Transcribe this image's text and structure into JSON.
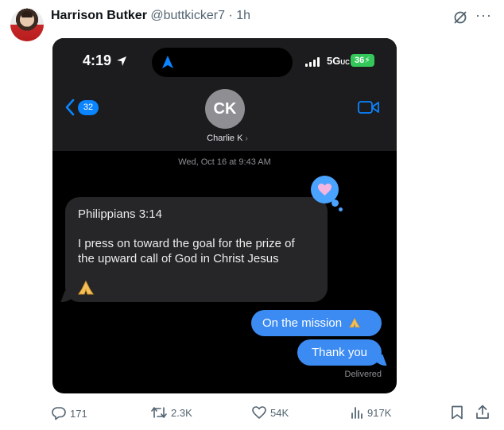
{
  "tweet": {
    "author_name": "Harrison Butker",
    "author_handle": "@buttkicker7",
    "time": "· 1h"
  },
  "phone": {
    "status_time": "4:19",
    "network": "5G",
    "network_suffix": "UC",
    "battery": "36",
    "back_count": "32",
    "contact_initials": "CK",
    "contact_name": "Charlie  K",
    "date_stamp": "Wed, Oct 16 at 9:43 AM",
    "incoming_message": {
      "line1": "Philippians 3:14",
      "line2": "I press on toward the goal for the prize of",
      "line3": "the upward call of God in Christ Jesus"
    },
    "outgoing_messages": [
      "On the mission",
      "Thank you"
    ],
    "delivered": "Delivered",
    "colors": {
      "bubble_blue": "#3b8bf2",
      "battery_green": "#34c759",
      "accent_blue": "#0a84ff"
    }
  },
  "actions": {
    "replies": "171",
    "reposts": "2.3K",
    "likes": "54K",
    "views": "917K"
  }
}
